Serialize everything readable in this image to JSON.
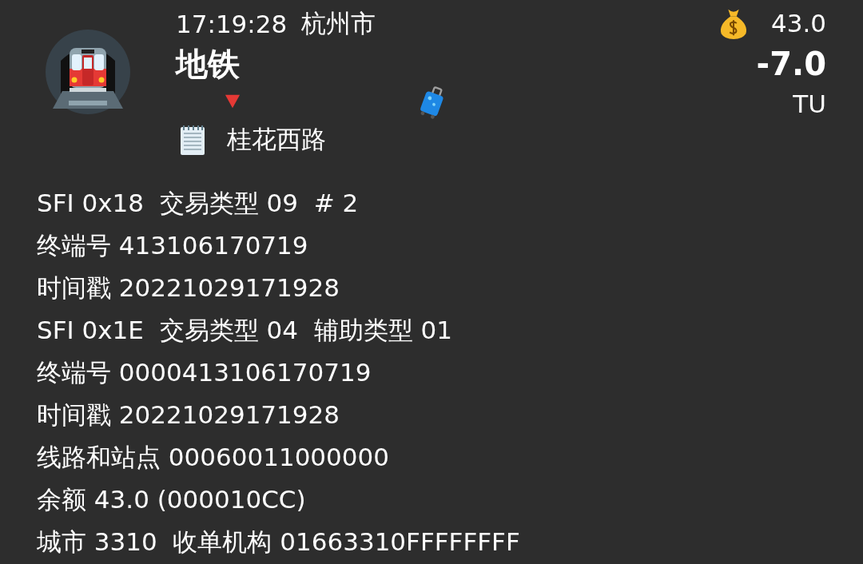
{
  "header": {
    "time": "17:19:28",
    "city": "杭州市",
    "type": "地铁",
    "station": "桂花西路",
    "balance": "43.0",
    "amount": "-7.0",
    "currency": "TU"
  },
  "lines": [
    "SFI 0x18  交易类型 09  # 2",
    "终端号 413106170719",
    "时间戳 20221029171928",
    "SFI 0x1E  交易类型 04  辅助类型 01",
    "终端号 0000413106170719",
    "时间戳 20221029171928",
    "线路和站点 00060011000000",
    "余额 43.0 (000010CC)",
    "城市 3310  收单机构 01663310FFFFFFFF"
  ]
}
